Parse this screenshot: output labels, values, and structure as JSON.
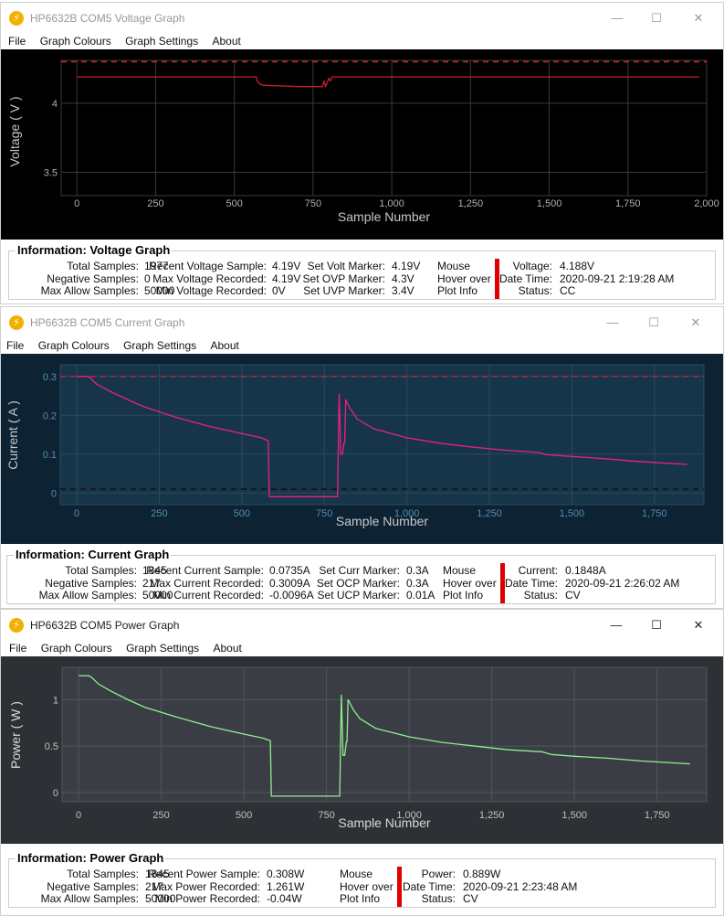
{
  "windows": [
    {
      "title": "HP6632B COM5 Voltage Graph",
      "menu": [
        "File",
        "Graph Colours",
        "Graph Settings",
        "About"
      ],
      "controls": {
        "minimize": "—",
        "maximize": "☐",
        "close": "✕"
      },
      "chart": {
        "ylabel": "Voltage ( V )",
        "xlabel": "Sample Number",
        "xticks": [
          "0",
          "250",
          "500",
          "750",
          "1,000",
          "1,250",
          "1,500",
          "1,750",
          "2,000"
        ],
        "yticks": [
          "4",
          "3.5"
        ]
      },
      "info": {
        "title": "Information: Voltage Graph",
        "c1l": [
          "Total Samples:",
          "Negative Samples:",
          "Max Allow Samples:"
        ],
        "c1v": [
          "1977",
          "0",
          "50000"
        ],
        "c2l": [
          "Recent Voltage Sample:",
          "Max Voltage Recorded:",
          "Min Voltage Recorded:"
        ],
        "c2v": [
          "4.19V",
          "4.19V",
          "0V"
        ],
        "c3l": [
          "Set Volt Marker:",
          "Set OVP Marker:",
          "Set UVP Marker:"
        ],
        "c3v": [
          "4.19V",
          "4.3V",
          "3.4V"
        ],
        "mouse": [
          "Mouse",
          "Hover over",
          "Plot Info"
        ],
        "c4l": [
          "Voltage:",
          "Date Time:",
          "Status:"
        ],
        "c4v": [
          "4.188V",
          "2020-09-21 2:19:28 AM",
          "CC"
        ]
      },
      "colors": {
        "bg": "#000000",
        "plot": "#000000",
        "grid": "#3a3a3a",
        "line": "#cc1f2a",
        "marker": "#cc2a2a",
        "text": "#b0b0b0",
        "label": "#c8c8c8"
      }
    },
    {
      "title": "HP6632B COM5 Current Graph",
      "menu": [
        "File",
        "Graph Colours",
        "Graph Settings",
        "About"
      ],
      "controls": {
        "minimize": "—",
        "maximize": "☐",
        "close": "✕"
      },
      "chart": {
        "ylabel": "Current ( A )",
        "xlabel": "Sample Number",
        "xticks": [
          "0",
          "250",
          "500",
          "750",
          "1,000",
          "1,250",
          "1,500",
          "1,750"
        ],
        "yticks": [
          "0.3",
          "0.2",
          "0.1",
          "0"
        ]
      },
      "info": {
        "title": "Information: Current Graph",
        "c1l": [
          "Total Samples:",
          "Negative Samples:",
          "Max Allow Samples:"
        ],
        "c1v": [
          "1845",
          "217",
          "50000"
        ],
        "c2l": [
          "Recent Current Sample:",
          "Max Current Recorded:",
          "Min Current Recorded:"
        ],
        "c2v": [
          "0.0735A",
          "0.3009A",
          "-0.0096A"
        ],
        "c3l": [
          "Set Curr Marker:",
          "Set OCP Marker:",
          "Set UCP Marker:"
        ],
        "c3v": [
          "0.3A",
          "0.3A",
          "0.01A"
        ],
        "mouse": [
          "Mouse",
          "Hover over",
          "Plot Info"
        ],
        "c4l": [
          "Current:",
          "Date Time:",
          "Status:"
        ],
        "c4v": [
          "0.1848A",
          "2020-09-21 2:26:02 AM",
          "CV"
        ]
      },
      "colors": {
        "bg": "#0d2233",
        "plot": "#163548",
        "grid": "#2a4a60",
        "line": "#e8208a",
        "marker": "#c0204a",
        "marker2": "#101010",
        "text": "#4f8fb0",
        "label": "#c8c8c8"
      }
    },
    {
      "title": "HP6632B COM5 Power Graph",
      "menu": [
        "File",
        "Graph Colours",
        "Graph Settings",
        "About"
      ],
      "controls": {
        "minimize": "—",
        "maximize": "☐",
        "close": "✕"
      },
      "chart": {
        "ylabel": "Power ( W )",
        "xlabel": "Sample Number",
        "xticks": [
          "0",
          "250",
          "500",
          "750",
          "1,000",
          "1,250",
          "1,500",
          "1,750"
        ],
        "yticks": [
          "1",
          "0.5",
          "0"
        ]
      },
      "info": {
        "title": "Information: Power Graph",
        "c1l": [
          "Total Samples:",
          "Negative Samples:",
          "Max Allow Samples:"
        ],
        "c1v": [
          "1845",
          "217",
          "50000"
        ],
        "c2l": [
          "Recent Power Sample:",
          "Max Power Recorded:",
          "Min Power Recorded:"
        ],
        "c2v": [
          "0.308W",
          "1.261W",
          "-0.04W"
        ],
        "mouse": [
          "Mouse",
          "Hover over",
          "Plot Info"
        ],
        "c4l": [
          "Power:",
          "Date Time:",
          "Status:"
        ],
        "c4v": [
          "0.889W",
          "2020-09-21 2:23:48 AM",
          "CV"
        ]
      },
      "colors": {
        "bg": "#2d3035",
        "plot": "#3a3e44",
        "grid": "#52565c",
        "line": "#90ee90",
        "text": "#c0c0c0",
        "label": "#d8d8d8"
      }
    }
  ],
  "chart_data": [
    {
      "type": "line",
      "xlabel": "Sample Number",
      "ylabel": "Voltage ( V )",
      "xlim": [
        -50,
        2000
      ],
      "ylim": [
        3.33,
        4.31
      ],
      "series": [
        {
          "x": [
            0,
            570,
            572,
            580,
            590,
            700,
            760,
            770,
            775,
            780,
            785,
            790,
            795,
            800,
            805,
            810,
            1977
          ],
          "y": [
            4.19,
            4.19,
            4.16,
            4.14,
            4.13,
            4.12,
            4.12,
            4.12,
            4.12,
            4.12,
            4.16,
            4.12,
            4.15,
            4.18,
            4.16,
            4.19,
            4.19
          ]
        }
      ],
      "markers": [
        {
          "y": 4.3,
          "color": "#cc2a2a"
        }
      ]
    },
    {
      "type": "line",
      "xlabel": "Sample Number",
      "ylabel": "Current ( A )",
      "xlim": [
        -50,
        1900
      ],
      "ylim": [
        -0.03,
        0.33
      ],
      "series": [
        {
          "x": [
            0,
            30,
            40,
            60,
            100,
            150,
            200,
            300,
            400,
            500,
            560,
            570,
            575,
            580,
            583,
            600,
            700,
            790,
            795,
            800,
            805,
            810,
            812,
            815,
            820,
            830,
            850,
            900,
            1000,
            1100,
            1200,
            1300,
            1400,
            1420,
            1430,
            1500,
            1600,
            1700,
            1850
          ],
          "y": [
            0.3,
            0.3,
            0.297,
            0.28,
            0.262,
            0.242,
            0.223,
            0.195,
            0.172,
            0.153,
            0.142,
            0.138,
            0.136,
            0.135,
            -0.0096,
            -0.0096,
            -0.0096,
            -0.0096,
            0.255,
            0.1,
            0.1,
            0.13,
            0.13,
            0.24,
            0.23,
            0.215,
            0.19,
            0.165,
            0.142,
            0.128,
            0.118,
            0.11,
            0.104,
            0.099,
            0.098,
            0.094,
            0.088,
            0.081,
            0.0735
          ]
        }
      ],
      "markers": [
        {
          "y": 0.3,
          "color": "#c0204a"
        },
        {
          "y": 0.01,
          "color": "#101010"
        }
      ]
    },
    {
      "type": "line",
      "xlabel": "Sample Number",
      "ylabel": "Power ( W )",
      "xlim": [
        -50,
        1900
      ],
      "ylim": [
        -0.1,
        1.35
      ],
      "series": [
        {
          "x": [
            0,
            30,
            40,
            60,
            100,
            150,
            200,
            300,
            400,
            500,
            560,
            570,
            575,
            580,
            583,
            600,
            700,
            790,
            795,
            800,
            805,
            810,
            812,
            815,
            820,
            830,
            850,
            900,
            1000,
            1100,
            1200,
            1300,
            1400,
            1420,
            1430,
            1500,
            1600,
            1700,
            1850
          ],
          "y": [
            1.26,
            1.26,
            1.24,
            1.17,
            1.09,
            1.0,
            0.92,
            0.81,
            0.71,
            0.63,
            0.585,
            0.57,
            0.565,
            0.56,
            -0.04,
            -0.04,
            -0.04,
            -0.04,
            1.05,
            0.4,
            0.4,
            0.55,
            0.55,
            1.0,
            0.97,
            0.9,
            0.8,
            0.69,
            0.6,
            0.54,
            0.5,
            0.46,
            0.44,
            0.42,
            0.41,
            0.39,
            0.37,
            0.34,
            0.308
          ]
        }
      ],
      "markers": []
    }
  ]
}
